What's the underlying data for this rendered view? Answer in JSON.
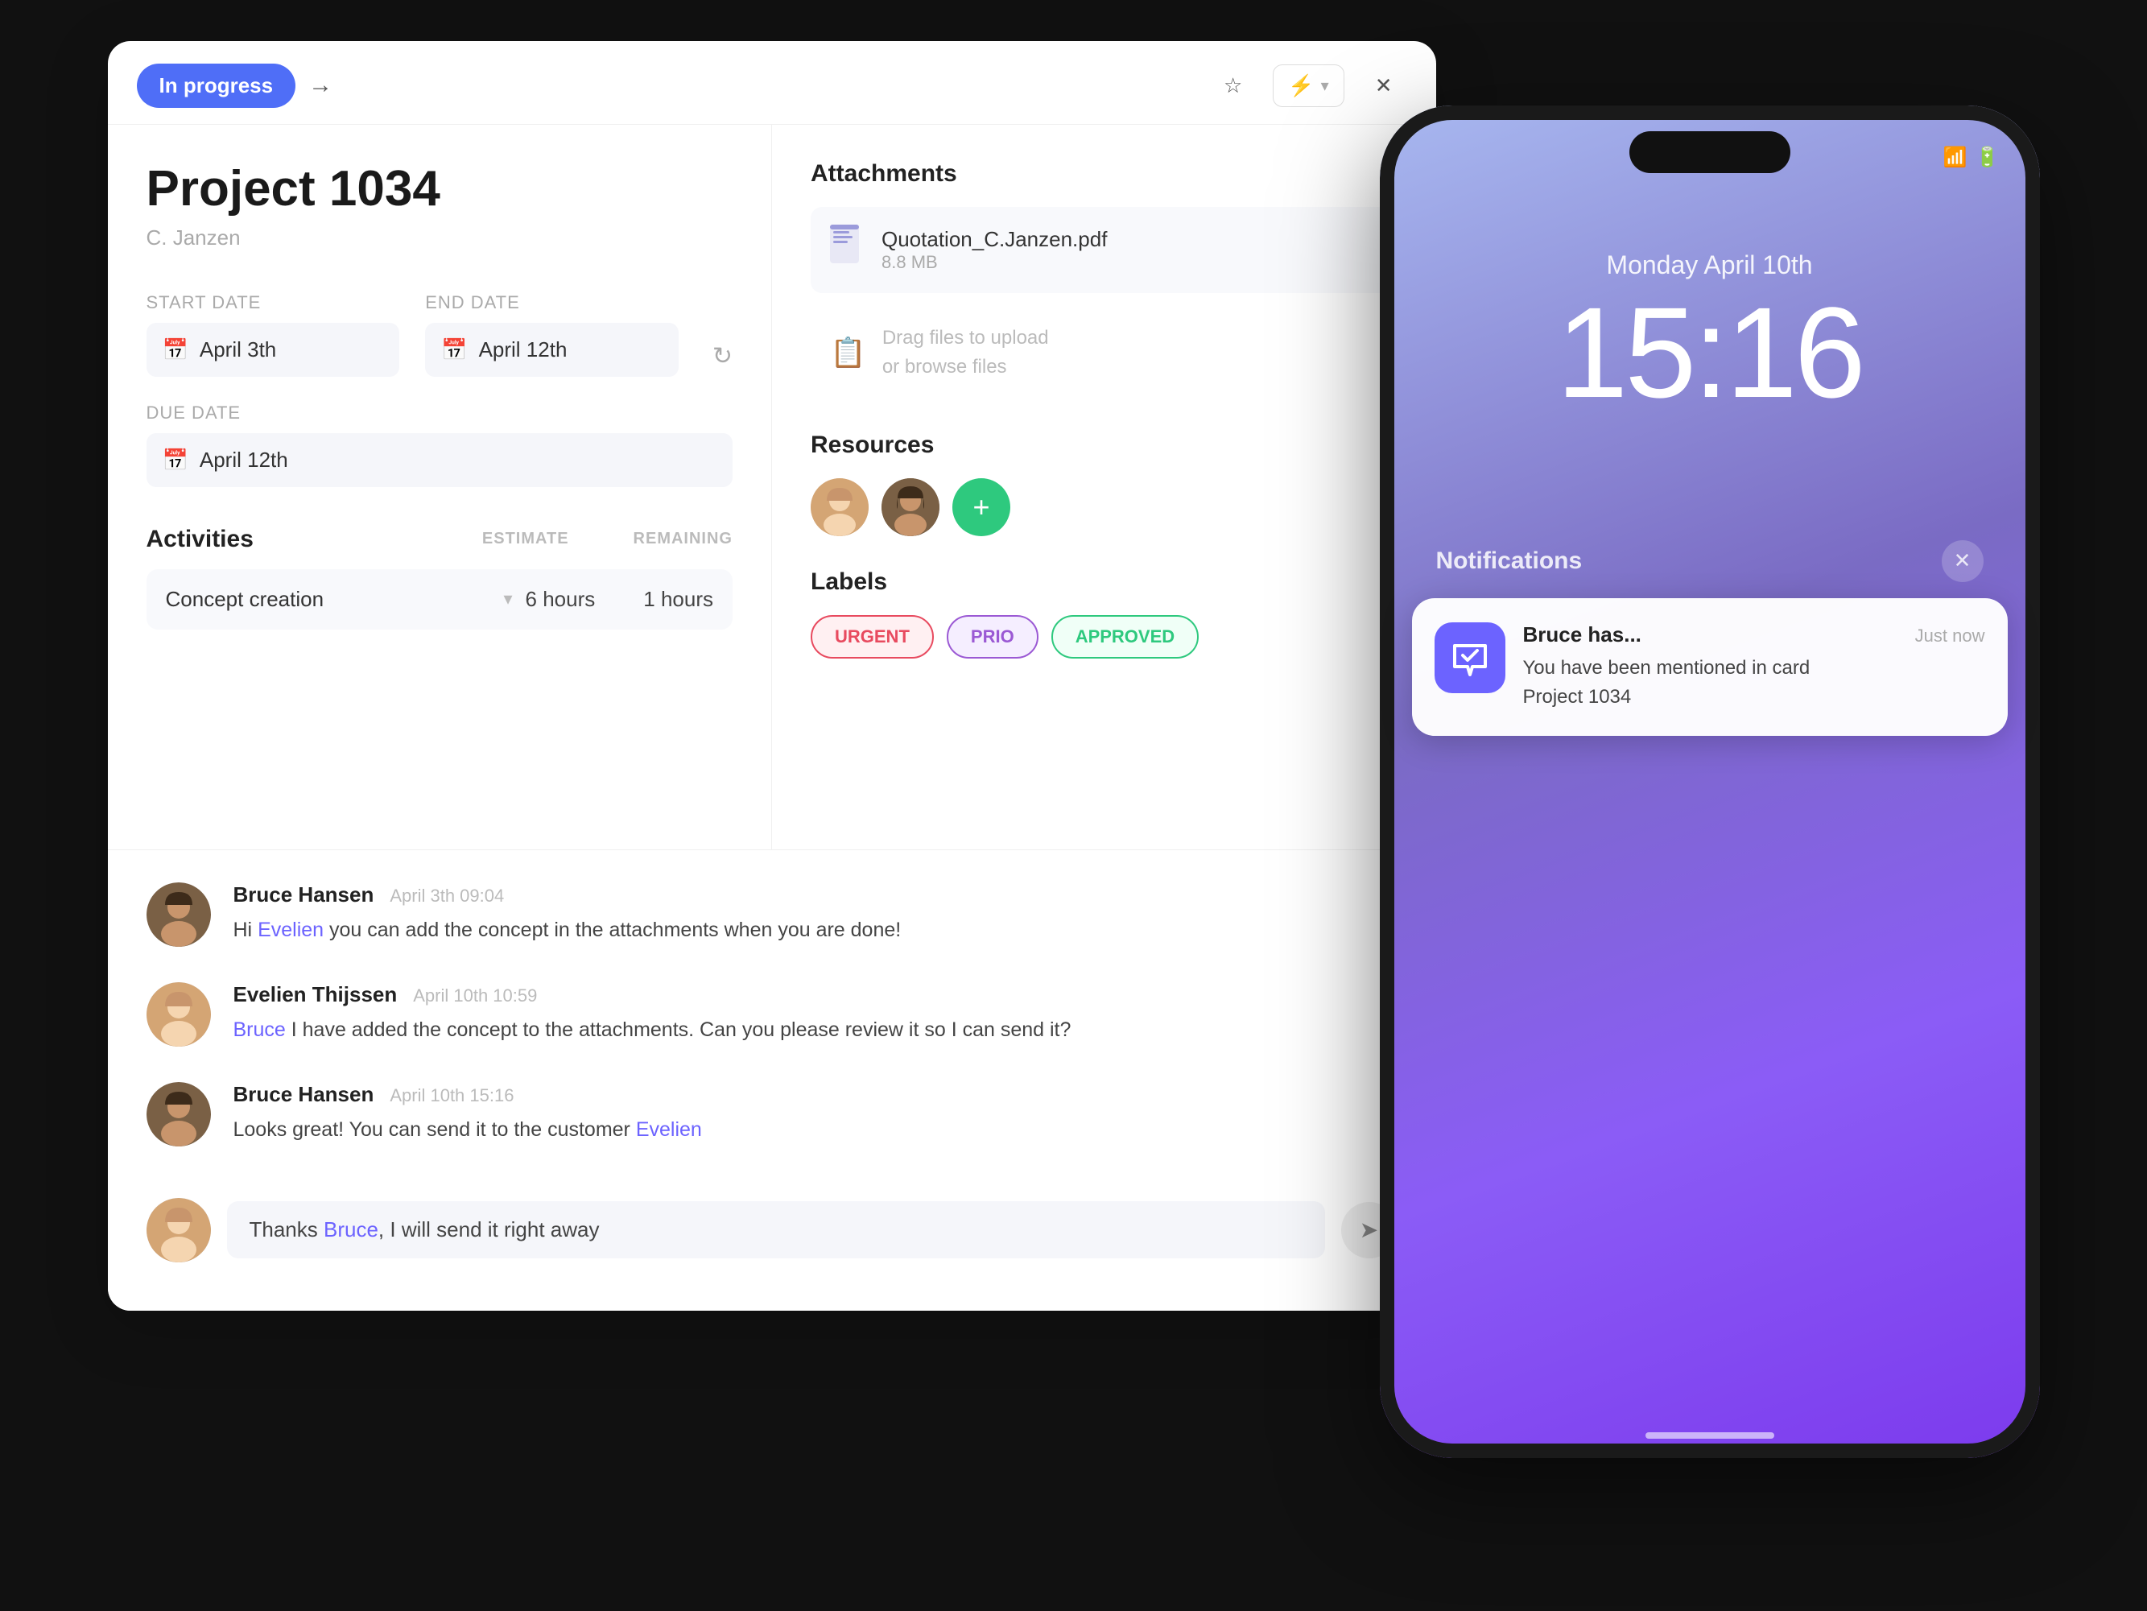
{
  "status_btn": "In progress",
  "project": {
    "title": "Project 1034",
    "owner": "C. Janzen"
  },
  "dates": {
    "start_label": "Start date",
    "end_label": "End date",
    "due_label": "Due date",
    "start_value": "April 3th",
    "end_value": "April 12th",
    "due_value": "April 12th"
  },
  "activities": {
    "title": "Activities",
    "estimate_label": "ESTIMATE",
    "remaining_label": "REMAINING",
    "items": [
      {
        "name": "Concept creation",
        "estimate": "6 hours",
        "remaining": "1 hours"
      }
    ]
  },
  "attachments": {
    "title": "Attachments",
    "items": [
      {
        "name": "Quotation_C.Janzen.pdf",
        "size": "8.8 MB"
      }
    ],
    "upload_text": "Drag files to upload",
    "upload_subtext": "or browse files"
  },
  "resources": {
    "title": "Resources"
  },
  "labels": {
    "title": "Labels",
    "items": [
      {
        "text": "URGENT",
        "class": "label-urgent"
      },
      {
        "text": "PRIO",
        "class": "label-prio"
      },
      {
        "text": "APPROVED",
        "class": "label-approved"
      }
    ]
  },
  "comments": [
    {
      "author": "Bruce Hansen",
      "time": "April 3th 09:04",
      "text_before": "Hi ",
      "mention": "Evelien",
      "text_after": " you can add the concept in the attachments when you are done!"
    },
    {
      "author": "Evelien Thijssen",
      "time": "April 10th 10:59",
      "mention": "Bruce",
      "text_before": "",
      "text_after": " I have added the concept to the attachments. Can you please review it so I can send it?"
    },
    {
      "author": "Bruce Hansen",
      "time": "April 10th 15:16",
      "text_before": "Looks great! You can send it to the customer ",
      "mention": "Evelien",
      "text_after": ""
    }
  ],
  "comment_input": {
    "placeholder": "Thanks Bruce, I will send it right away",
    "value": "Thanks Bruce, I will send it right away"
  },
  "phone": {
    "date": "Monday April 10th",
    "time": "15:16",
    "notifications_label": "Notifications",
    "notification": {
      "app": "Bruce has...",
      "time": "Just now",
      "line1": "You have been mentioned in card",
      "line2": "Project 1034"
    }
  }
}
